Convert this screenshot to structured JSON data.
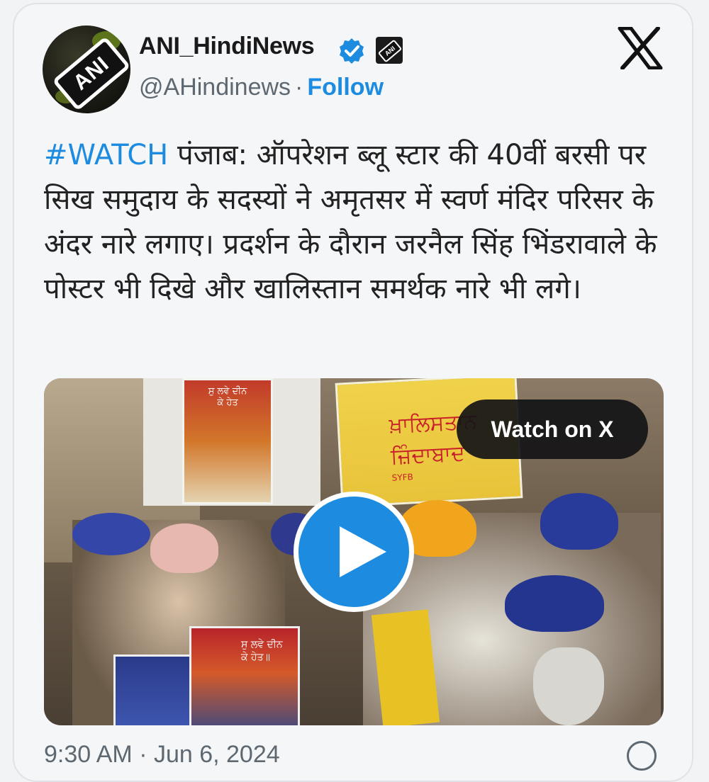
{
  "tweet": {
    "author_name": "ANI_HindiNews",
    "handle": "@AHindinews",
    "separator": "·",
    "follow_label": "Follow",
    "avatar_text": "ANI",
    "hashtag": "#WATCH",
    "text": " पंजाब: ऑपरेशन ब्लू स्टार की 40वीं बरसी पर सिख समुदाय के सदस्यों ने अमृतसर में स्वर्ण मंदिर परिसर के अंदर नारे लगाए। प्रदर्शन के दौरान जरनैल सिंह भिंडरावाले के पोस्टर भी दिखे और खालिस्तान समर्थक नारे भी लगे।",
    "footer_partial": "9:30 AM · Jun 6, 2024"
  },
  "media": {
    "watch_label": "Watch on X",
    "poster_top_text": "ਸੁ ਲਵੇ ਦੀਨ\nਕੇ ਹੇਤ",
    "poster_yellow_text": "ਖ਼ਾਲਿਸਤਾਨ\nਜ਼ਿੰਦਾਬਾਦ",
    "poster_yellow_small": "SYFB",
    "poster_bottom_text": "ਸੁ ਲਵੇ ਦੀਨ\nਕੇ ਹੇਤ॥"
  },
  "icons": {
    "verified": "verified-badge-icon",
    "affiliate": "ani-affiliate-icon",
    "x_logo": "x-logo-icon",
    "play": "play-icon",
    "info": "info-icon"
  },
  "colors": {
    "accent": "#1d8ce0",
    "text": "#222222",
    "muted": "#5e6870",
    "card_bg": "#f5f6f8"
  }
}
